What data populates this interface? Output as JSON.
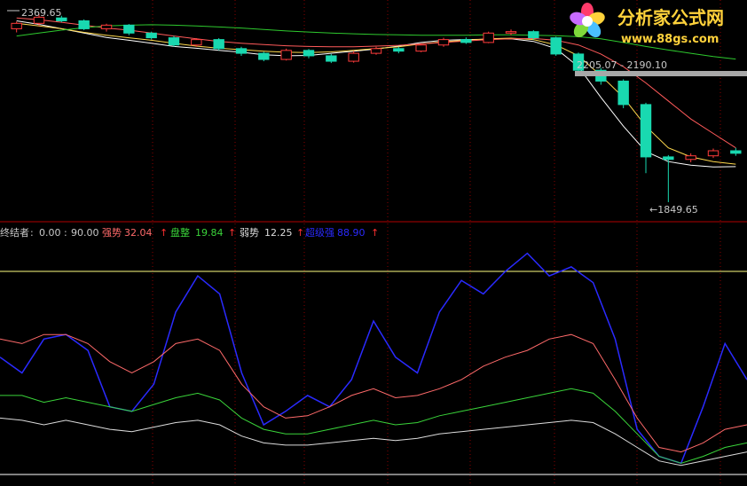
{
  "chart_data": [
    {
      "type": "candlestick",
      "labels": {
        "high_marker": "2369.65",
        "range_marker": "2205.07 - 2190.10",
        "low_marker": "←1849.65"
      },
      "ylim": [
        1820,
        2390
      ],
      "moving_averages": [
        {
          "color": "#ffffff",
          "values": [
            2352,
            2342,
            2330,
            2318,
            2306,
            2298,
            2290,
            2281,
            2276,
            2270,
            2265,
            2258,
            2255,
            2256,
            2262,
            2268,
            2274,
            2282,
            2292,
            2298,
            2300,
            2301,
            2302,
            2295,
            2275,
            2225,
            2140,
            2060,
            1990,
            1962,
            1952,
            1947,
            1948
          ]
        },
        {
          "color": "#ffd94d",
          "values": [
            2345,
            2338,
            2330,
            2320,
            2312,
            2305,
            2298,
            2290,
            2282,
            2276,
            2272,
            2268,
            2265,
            2264,
            2266,
            2270,
            2275,
            2280,
            2288,
            2294,
            2298,
            2302,
            2304,
            2300,
            2285,
            2255,
            2200,
            2140,
            2060,
            2000,
            1975,
            1962,
            1955
          ]
        },
        {
          "color": "#ff5a5a",
          "values": [
            2360,
            2355,
            2348,
            2340,
            2332,
            2326,
            2318,
            2310,
            2302,
            2295,
            2290,
            2286,
            2283,
            2281,
            2280,
            2280,
            2282,
            2284,
            2288,
            2292,
            2296,
            2300,
            2302,
            2303,
            2298,
            2285,
            2260,
            2225,
            2180,
            2130,
            2080,
            2040,
            2000
          ]
        },
        {
          "color": "#2ec92e",
          "values": [
            2310,
            2318,
            2326,
            2333,
            2338,
            2340,
            2341,
            2340,
            2338,
            2335,
            2332,
            2328,
            2324,
            2321,
            2318,
            2316,
            2314,
            2313,
            2312,
            2312,
            2312,
            2313,
            2313,
            2312,
            2311,
            2308,
            2302,
            2292,
            2281,
            2271,
            2262,
            2253,
            2246
          ]
        }
      ],
      "candles": [
        [
          2330,
          2345,
          2320,
          2350
        ],
        [
          2345,
          2362,
          2338,
          2369.65
        ],
        [
          2360,
          2352,
          2348,
          2366
        ],
        [
          2352,
          2330,
          2326,
          2356
        ],
        [
          2330,
          2340,
          2322,
          2344
        ],
        [
          2340,
          2318,
          2312,
          2343
        ],
        [
          2318,
          2305,
          2300,
          2322
        ],
        [
          2305,
          2285,
          2280,
          2310
        ],
        [
          2285,
          2300,
          2280,
          2304
        ],
        [
          2300,
          2275,
          2270,
          2304
        ],
        [
          2275,
          2262,
          2255,
          2280
        ],
        [
          2262,
          2245,
          2240,
          2266
        ],
        [
          2245,
          2270,
          2242,
          2275
        ],
        [
          2270,
          2255,
          2248,
          2274
        ],
        [
          2255,
          2240,
          2235,
          2260
        ],
        [
          2240,
          2262,
          2236,
          2268
        ],
        [
          2262,
          2275,
          2258,
          2280
        ],
        [
          2275,
          2268,
          2262,
          2280
        ],
        [
          2268,
          2285,
          2265,
          2290
        ],
        [
          2285,
          2300,
          2280,
          2305
        ],
        [
          2300,
          2292,
          2288,
          2306
        ],
        [
          2292,
          2318,
          2290,
          2322
        ],
        [
          2318,
          2322,
          2312,
          2328
        ],
        [
          2322,
          2305,
          2300,
          2326
        ],
        [
          2305,
          2260,
          2255,
          2308
        ],
        [
          2260,
          2215,
          2205.07,
          2264
        ],
        [
          2215,
          2185,
          2175,
          2222
        ],
        [
          2185,
          2120,
          2110,
          2190
        ],
        [
          2120,
          1975,
          1930,
          2125
        ],
        [
          1975,
          1968,
          1849.65,
          1980
        ],
        [
          1968,
          1978,
          1960,
          1985
        ],
        [
          1978,
          1992,
          1972,
          1998
        ],
        [
          1992,
          1985,
          1978,
          2000
        ]
      ],
      "overlay": {
        "range_bar_value": 2205.07
      }
    },
    {
      "type": "line",
      "legend": {
        "title": "终结者",
        "sep1": ":",
        "v1": "0.00",
        "sep2": ":",
        "v2": "90.00",
        "series": [
          {
            "name": "强势",
            "value": "32.04",
            "arrow": "↑",
            "color": "#ff6a6a"
          },
          {
            "name": "盘整",
            "value": "19.84",
            "arrow": "↑",
            "color": "#3ad43a"
          },
          {
            "name": "弱势",
            "value": "12.25",
            "arrow": "↑",
            "color": "#dcdcdc"
          },
          {
            "name": "超级强",
            "value": "88.90",
            "arrow": "↑",
            "color": "#2a2aff"
          }
        ]
      },
      "ylim": [
        0,
        100
      ],
      "hlines": [
        {
          "value": 90.0,
          "color": "#ffff80"
        },
        {
          "value": 0.0,
          "color": "#ffffff"
        }
      ],
      "series": [
        {
          "name": "超级强",
          "color": "#2a2aff",
          "values": [
            52,
            45,
            60,
            62,
            55,
            30,
            28,
            40,
            72,
            88,
            80,
            45,
            22,
            28,
            35,
            30,
            42,
            68,
            52,
            45,
            72,
            86,
            80,
            90,
            98,
            88,
            92,
            85,
            60,
            20,
            8,
            5,
            30,
            58,
            42
          ]
        },
        {
          "name": "强势",
          "color": "#ff6a6a",
          "values": [
            60,
            58,
            62,
            62,
            58,
            50,
            45,
            50,
            58,
            60,
            55,
            40,
            30,
            25,
            26,
            30,
            35,
            38,
            34,
            35,
            38,
            42,
            48,
            52,
            55,
            60,
            62,
            58,
            42,
            25,
            12,
            10,
            14,
            20,
            22
          ]
        },
        {
          "name": "盘整",
          "color": "#3ad43a",
          "values": [
            35,
            35,
            32,
            34,
            32,
            30,
            28,
            31,
            34,
            36,
            33,
            25,
            20,
            18,
            18,
            20,
            22,
            24,
            22,
            23,
            26,
            28,
            30,
            32,
            34,
            36,
            38,
            36,
            28,
            18,
            8,
            5,
            8,
            12,
            14
          ]
        },
        {
          "name": "弱势",
          "color": "#dcdcdc",
          "values": [
            25,
            24,
            22,
            24,
            22,
            20,
            19,
            21,
            23,
            24,
            22,
            17,
            14,
            13,
            13,
            14,
            15,
            16,
            15,
            16,
            18,
            19,
            20,
            21,
            22,
            23,
            24,
            23,
            18,
            12,
            6,
            4,
            6,
            8,
            10
          ]
        }
      ]
    }
  ],
  "watermark": {
    "text": "分析家公式网",
    "url": "www.88gs.com",
    "logo_icon": "flower-logo-icon"
  }
}
